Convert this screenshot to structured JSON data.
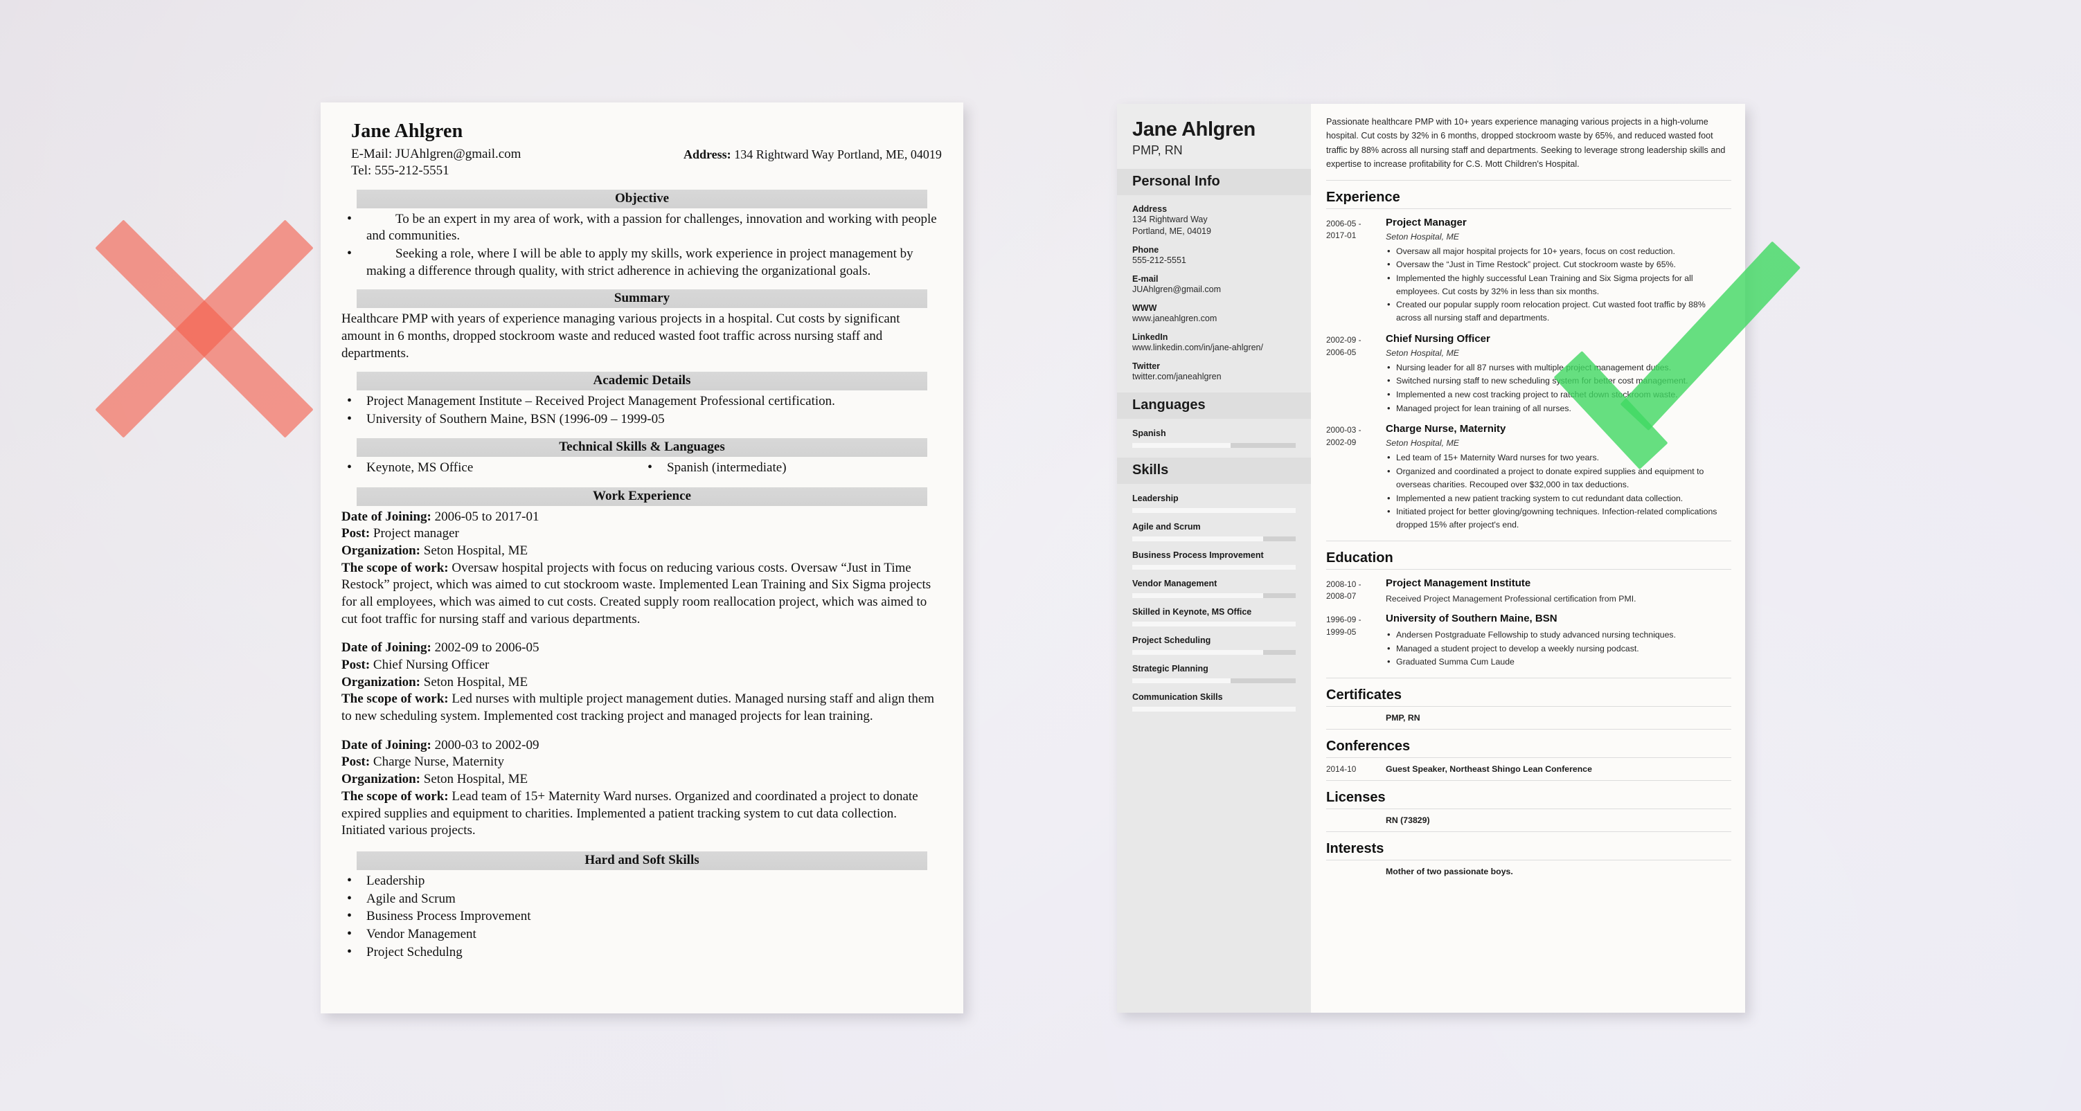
{
  "background": {
    "color": "#e9e6ee"
  },
  "marks": {
    "reject": {
      "name": "red-x-mark",
      "color": "#f4604c",
      "meaning": "bad resume example"
    },
    "approve": {
      "name": "green-check-mark",
      "color": "#40d862",
      "meaning": "good resume example"
    }
  },
  "bad_resume": {
    "name": "Jane Ahlgren",
    "email_line": "E-Mail: JUAhlgren@gmail.com",
    "tel_line": "Tel: 555-212-5551",
    "address_label": "Address:",
    "address_value": "134 Rightward Way Portland, ME, 04019",
    "sections": {
      "objective": {
        "heading": "Objective",
        "bullets": [
          "To be an expert in my area of work, with a passion for challenges, innovation and working with people and communities.",
          "Seeking a role, where I will be able to apply my skills, work experience in project management by making a difference through quality, with strict adherence in achieving the organizational goals."
        ]
      },
      "summary": {
        "heading": "Summary",
        "text": "Healthcare PMP with years of experience managing various projects in a hospital. Cut costs by significant amount in 6 months, dropped stockroom waste and reduced wasted foot traffic across nursing staff and departments."
      },
      "academic": {
        "heading": "Academic Details",
        "bullets": [
          "Project Management Institute – Received Project Management Professional certification.",
          "University of Southern Maine, BSN (1996-09 – 1999-05"
        ]
      },
      "technical": {
        "heading": "Technical Skills & Languages",
        "left": "Keynote, MS Office",
        "right": "Spanish (intermediate)"
      },
      "work": {
        "heading": "Work Experience",
        "labels": {
          "date": "Date of Joining:",
          "post": "Post:",
          "org": "Organization:",
          "scope": "The scope of work:"
        },
        "jobs": [
          {
            "date": "2006-05 to 2017-01",
            "post": "Project manager",
            "org": "Seton Hospital, ME",
            "scope": "Oversaw hospital projects with focus on reducing various costs. Oversaw “Just in Time Restock” project, which was aimed to cut stockroom waste. Implemented Lean Training and Six Sigma projects for all employees, which was aimed to cut costs. Created supply room reallocation project, which was aimed to cut foot traffic for nursing staff and various departments."
          },
          {
            "date": "2002-09 to 2006-05",
            "post": "Chief Nursing Officer",
            "org": "Seton Hospital, ME",
            "scope": "Led nurses with multiple project management duties. Managed nursing staff and align them to new scheduling system. Implemented cost tracking project and managed projects for lean training."
          },
          {
            "date": "2000-03 to 2002-09",
            "post": "Charge Nurse, Maternity",
            "org": "Seton Hospital, ME",
            "scope": "Lead team of 15+ Maternity Ward nurses. Organized and coordinated a project to donate expired supplies and equipment to charities. Implemented a patient tracking system to cut data collection. Initiated various projects."
          }
        ]
      },
      "hard_soft": {
        "heading": "Hard and Soft Skills",
        "items": [
          "Leadership",
          "Agile and Scrum",
          "Business Process Improvement",
          "Vendor Management",
          "Project Schedulng"
        ]
      }
    }
  },
  "good_resume": {
    "sidebar": {
      "name": "Jane Ahlgren",
      "title": "PMP, RN",
      "personal_info_heading": "Personal Info",
      "fields": [
        {
          "label": "Address",
          "value": "134 Rightward Way\nPortland, ME, 04019"
        },
        {
          "label": "Phone",
          "value": "555-212-5551"
        },
        {
          "label": "E-mail",
          "value": "JUAhlgren@gmail.com"
        },
        {
          "label": "WWW",
          "value": "www.janeahlgren.com"
        },
        {
          "label": "LinkedIn",
          "value": "www.linkedin.com/in/jane-ahlgren/"
        },
        {
          "label": "Twitter",
          "value": "twitter.com/janeahlgren"
        }
      ],
      "languages_heading": "Languages",
      "languages": [
        {
          "name": "Spanish",
          "level": 60
        }
      ],
      "skills_heading": "Skills",
      "skills": [
        {
          "name": "Leadership",
          "level": 100
        },
        {
          "name": "Agile and Scrum",
          "level": 80
        },
        {
          "name": "Business Process Improvement",
          "level": 100
        },
        {
          "name": "Vendor Management",
          "level": 80
        },
        {
          "name": "Skilled in Keynote, MS Office",
          "level": 100
        },
        {
          "name": "Project Scheduling",
          "level": 80
        },
        {
          "name": "Strategic Planning",
          "level": 60
        },
        {
          "name": "Communication Skills",
          "level": 100
        }
      ]
    },
    "lead": "Passionate healthcare PMP with 10+ years experience managing various projects in a high-volume hospital. Cut costs by 32% in 6 months, dropped stockroom waste by 65%, and reduced wasted foot traffic by 88% across all nursing staff and departments. Seeking to leverage strong leadership skills and expertise to increase profitability for C.S. Mott Children's Hospital.",
    "experience": {
      "heading": "Experience",
      "entries": [
        {
          "dates": "2006-05 -\n2017-01",
          "title": "Project Manager",
          "org": "Seton Hospital, ME",
          "bullets": [
            "Oversaw all major hospital projects for 10+ years, focus on cost reduction.",
            "Oversaw the “Just in Time Restock” project. Cut stockroom waste by 65%.",
            "Implemented the highly successful Lean Training and Six Sigma projects for all employees. Cut costs by 32% in less than six months.",
            "Created our popular supply room relocation project. Cut wasted foot traffic by 88% across all nursing staff and departments."
          ]
        },
        {
          "dates": "2002-09 -\n2006-05",
          "title": "Chief Nursing Officer",
          "org": "Seton Hospital, ME",
          "bullets": [
            "Nursing leader for all 87 nurses with multiple project management duties.",
            "Switched nursing staff to new scheduling system for better cost management.",
            "Implemented a new cost tracking project to ratchet down stockroom waste.",
            "Managed project for lean training of all nurses."
          ]
        },
        {
          "dates": "2000-03 -\n2002-09",
          "title": "Charge Nurse, Maternity",
          "org": "Seton Hospital, ME",
          "bullets": [
            "Led team of 15+ Maternity Ward nurses for two years.",
            "Organized and coordinated a project to donate expired supplies and equipment to overseas charities. Recouped over $32,000 in tax deductions.",
            "Implemented a new patient tracking system to cut redundant data collection.",
            "Initiated project for better gloving/gowning techniques. Infection-related complications dropped 15% after project's end."
          ]
        }
      ]
    },
    "education": {
      "heading": "Education",
      "entries": [
        {
          "dates": "2008-10 -\n2008-07",
          "title": "Project Management Institute",
          "sub": "Received Project Management Professional certification from PMI.",
          "bullets": []
        },
        {
          "dates": "1996-09 -\n1999-05",
          "title": "University of Southern Maine, BSN",
          "sub": "",
          "bullets": [
            "Andersen Postgraduate Fellowship to study advanced nursing techniques.",
            "Managed a student project to develop a weekly nursing podcast.",
            "Graduated Summa Cum Laude"
          ]
        }
      ]
    },
    "certificates": {
      "heading": "Certificates",
      "dates": "",
      "text": "PMP, RN"
    },
    "conferences": {
      "heading": "Conferences",
      "dates": "2014-10",
      "text": "Guest Speaker, Northeast Shingo Lean Conference"
    },
    "licenses": {
      "heading": "Licenses",
      "dates": "",
      "text": "RN (73829)"
    },
    "interests": {
      "heading": "Interests",
      "dates": "",
      "text": "Mother of two passionate boys."
    }
  }
}
